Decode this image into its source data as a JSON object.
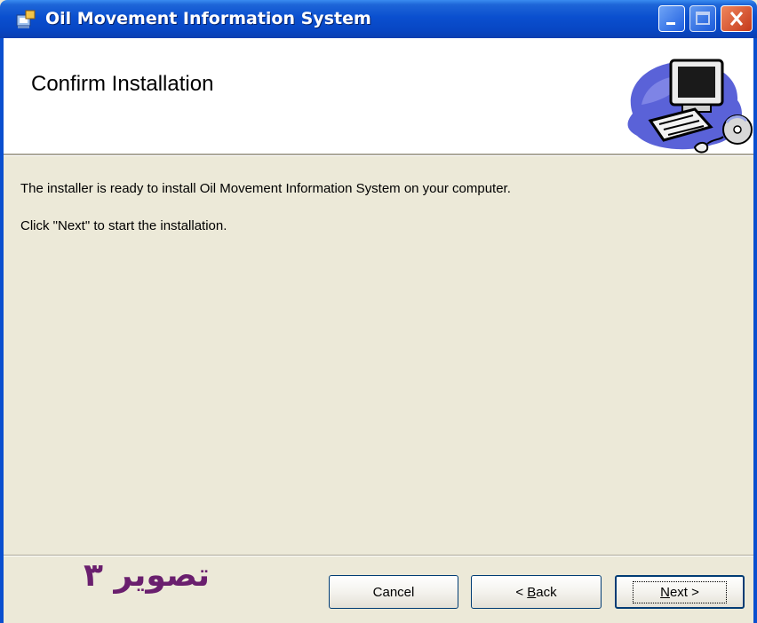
{
  "window": {
    "title": "Oil Movement Information System",
    "icons": {
      "app": "installer-icon",
      "minimize": "minimize-icon",
      "maximize": "maximize-icon",
      "close": "close-icon"
    }
  },
  "header": {
    "title": "Confirm Installation",
    "art": "computer-with-cd-icon"
  },
  "body": {
    "line1": "The installer is ready to install Oil Movement Information System on your computer.",
    "line2": "Click \"Next\" to start the installation."
  },
  "footer": {
    "watermark": "تصویر ۳",
    "buttons": {
      "cancel": "Cancel",
      "back_prefix": "< ",
      "back_mnemonic": "B",
      "back_rest": "ack",
      "next_mnemonic": "N",
      "next_rest": "ext >"
    }
  },
  "colors": {
    "titlebar": "#0a4fcf",
    "dialog_bg": "#ece9d8",
    "header_bg": "#ffffff",
    "watermark": "#6a1f6e",
    "close_button": "#c4391a"
  }
}
